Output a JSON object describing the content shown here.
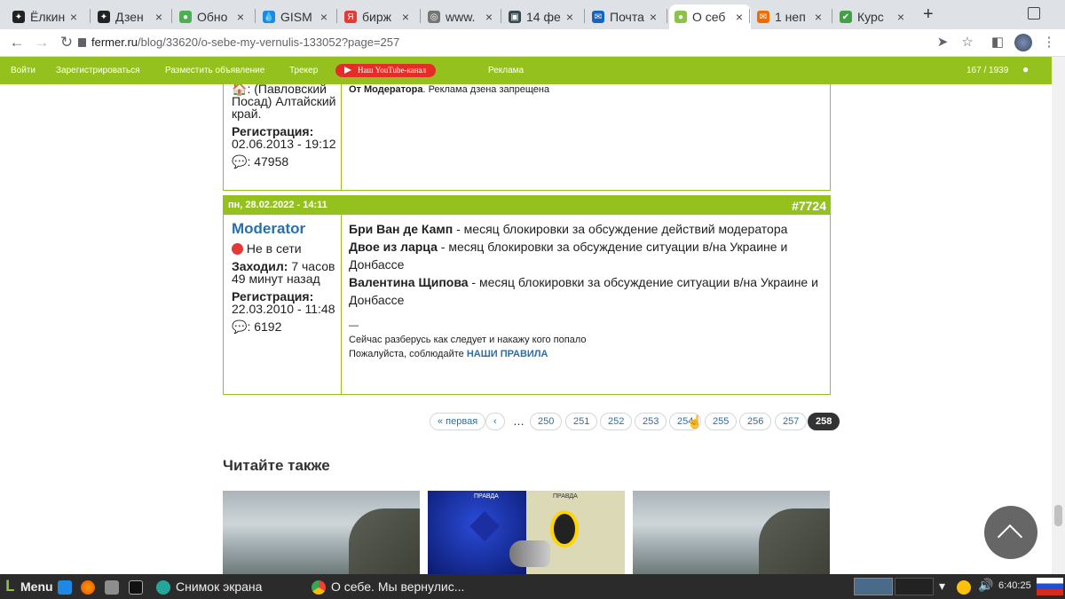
{
  "browser": {
    "tabs": [
      {
        "title": "Ёлкин",
        "color": "#222",
        "glyph": "✦"
      },
      {
        "title": "Дзен",
        "color": "#222",
        "glyph": "✦"
      },
      {
        "title": "Обно",
        "color": "#4caf50",
        "glyph": "●"
      },
      {
        "title": "GISM",
        "color": "#1e88e5",
        "glyph": "💧"
      },
      {
        "title": "бирж",
        "color": "#e53935",
        "glyph": "Я"
      },
      {
        "title": "www.",
        "color": "#757575",
        "glyph": "◎"
      },
      {
        "title": "14 фе",
        "color": "#37474f",
        "glyph": "▣"
      },
      {
        "title": "Почта",
        "color": "#1565c0",
        "glyph": "✉"
      },
      {
        "title": "О себ",
        "color": "#8bc34a",
        "glyph": "●",
        "active": true
      },
      {
        "title": "1 неп",
        "color": "#ef6c00",
        "glyph": "✉"
      },
      {
        "title": "Курс",
        "color": "#43a047",
        "glyph": "✔"
      }
    ],
    "url_host": "fermer.ru",
    "url_path": "/blog/33620/o-sebe-my-vernulis-133052?page=257",
    "new_tab_label": "+"
  },
  "sitenav": {
    "login": "Войти",
    "register": "Зарегистрироваться",
    "post_ad": "Разместить объявление",
    "tracker": "Трекер",
    "youtube": "Наш YouTube-канал",
    "ads": "Реклама",
    "counter": "167 / 1939"
  },
  "post1": {
    "location": ": (Павловский Посад) Алтайский край.",
    "reg_label": "Регистрация:",
    "reg_date": "02.06.2013 - 19:12",
    "comments": ": 47958",
    "moder_label": "От Модератора",
    "moder_text": ". Реклама дзена запрещена"
  },
  "post2": {
    "date": "пн, 28.02.2022 - 14:11",
    "number": "#7724",
    "author": "Moderator",
    "status": "Не в сети",
    "visit_label": "Заходил:",
    "visit_value": "7 часов 49 минут назад",
    "reg_label": "Регистрация:",
    "reg_date": "22.03.2010 - 11:48",
    "comments": ": 6192",
    "lines": [
      {
        "name": "Бри Ван де Камп",
        "text": " - месяц блокировки за обсуждение действий модератора"
      },
      {
        "name": "Двое из ларца",
        "text": " - месяц блокировки за обсуждение ситуации в/на Украине и Донбассе"
      },
      {
        "name": "Валентина Щипова",
        "text": " - месяц блокировки за обсуждение ситуации в/на Украине и Донбассе"
      }
    ],
    "dash": "—",
    "sig1": "Сейчас разберусь как следует и накажу кого попало",
    "sig2_prefix": "Пожалуйста, соблюдайте ",
    "sig2_link": "НАШИ ПРАВИЛА"
  },
  "pager": {
    "first": "« первая",
    "prev": "‹",
    "ellipsis": "…",
    "pages": [
      "250",
      "251",
      "252",
      "253",
      "254",
      "255",
      "256",
      "257"
    ],
    "current": "258"
  },
  "read_also": "Читайте также",
  "card2": {
    "label_left": "ПРАВДА",
    "label_right": "ПРАВДА"
  },
  "taskbar": {
    "menu": "Menu",
    "app1": "Снимок экрана",
    "app2": "О себе. Мы вернулис...",
    "clock": "6:40:25"
  }
}
